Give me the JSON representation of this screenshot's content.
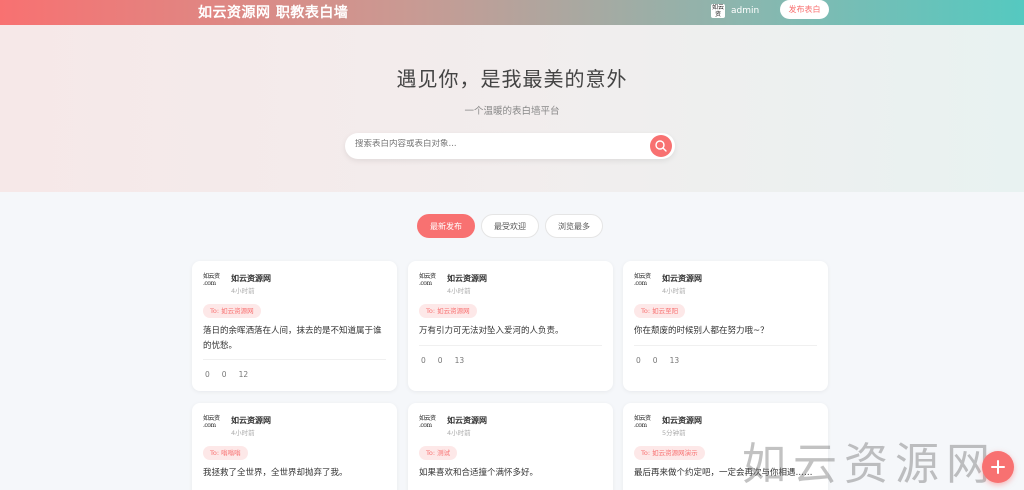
{
  "header": {
    "brand": "如云资源网 职教表白墙",
    "user_name": "admin",
    "avatar_text": "如云资",
    "post_button": "发布表白"
  },
  "hero": {
    "title": "遇见你，是我最美的意外",
    "subtitle": "一个温暖的表白墙平台",
    "search_placeholder": "搜索表白内容或表白对象..."
  },
  "tabs": [
    "最新发布",
    "最受欢迎",
    "浏览最多"
  ],
  "cards": [
    {
      "avatar": "如云资 .com",
      "author": "如云资源网",
      "time": "4小时前",
      "to": "To: 如云资源网",
      "text": "落日的余晖洒落在人间，抹去的是不知道属于谁的忧愁。",
      "likes": "0",
      "comments": "0",
      "views": "12"
    },
    {
      "avatar": "如云资 .com",
      "author": "如云资源网",
      "time": "4小时前",
      "to": "To: 如云资源网",
      "text": "万有引力可无法对坠入爱河的人负责。",
      "likes": "0",
      "comments": "0",
      "views": "13"
    },
    {
      "avatar": "如云资 .com",
      "author": "如云资源网",
      "time": "4小时前",
      "to": "To: 如云至阳",
      "text": "你在颓废的时候别人都在努力哦~？",
      "likes": "0",
      "comments": "0",
      "views": "13"
    },
    {
      "avatar": "如云资 .com",
      "author": "如云资源网",
      "time": "4小时前",
      "to": "To: 嗡嗡嗡",
      "text": "我拯救了全世界，全世界却抛弃了我。",
      "likes": "",
      "comments": "",
      "views": ""
    },
    {
      "avatar": "如云资 .com",
      "author": "如云资源网",
      "time": "4小时前",
      "to": "To: 测试",
      "text": "如果喜欢和合适撞个满怀多好。",
      "likes": "",
      "comments": "",
      "views": ""
    },
    {
      "avatar": "如云资 .com",
      "author": "如云资源网",
      "time": "5分钟前",
      "to": "To: 如云资源网演示",
      "text": "最后再来做个约定吧，一定会再次与你相遇……",
      "likes": "",
      "comments": "",
      "views": ""
    }
  ],
  "watermark": "如云资源网",
  "colors": {
    "accent": "#f87171",
    "teal": "#55c9c0"
  }
}
